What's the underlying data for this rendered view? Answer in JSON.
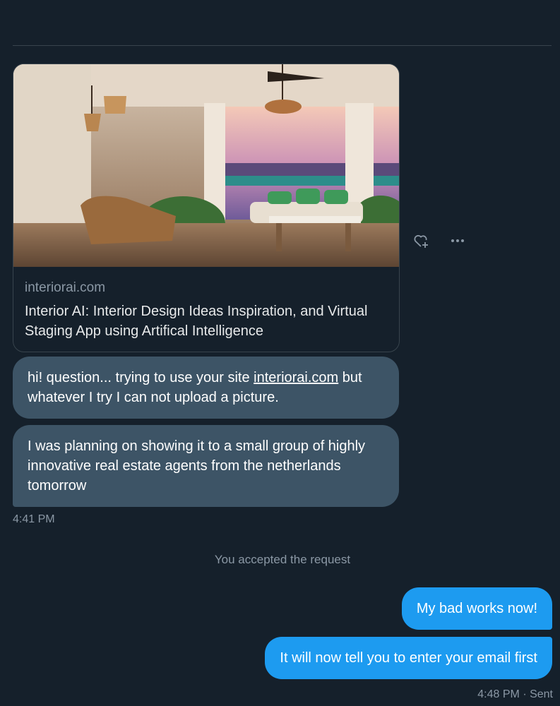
{
  "link_card": {
    "domain": "interiorai.com",
    "title": "Interior AI: Interior Design Ideas Inspiration, and Virtual Staging App using Artifical Intelligence"
  },
  "actions": {
    "react_icon": "heart-plus-icon",
    "more_icon": "more-icon"
  },
  "messages_in": [
    {
      "text_before": "hi! question... trying to use your site ",
      "link": "interiorai.com",
      "text_after": " but whatever I try I can not upload a picture."
    },
    {
      "text": "I was planning on showing it to a small group of highly innovative real estate agents from the netherlands tomorrow"
    }
  ],
  "time_in": "4:41 PM",
  "system_message": "You accepted the request",
  "messages_out": [
    {
      "text": "My bad works now!"
    },
    {
      "text": "It will now tell you to enter your email first"
    }
  ],
  "time_out": "4:48 PM · Sent",
  "colors": {
    "background": "#15202b",
    "incoming_bubble": "#3d5466",
    "outgoing_bubble": "#1d9bf0",
    "muted_text": "#8b98a5"
  }
}
